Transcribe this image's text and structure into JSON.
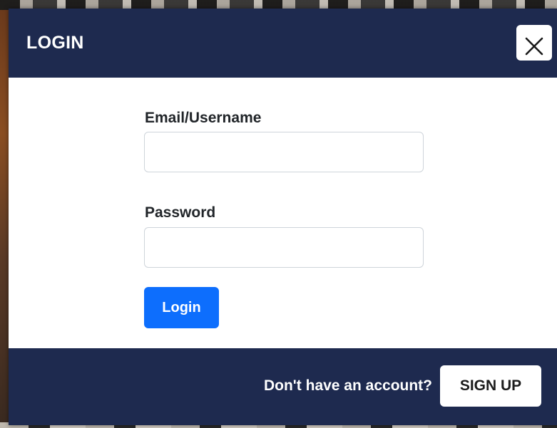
{
  "modal": {
    "title": "LOGIN",
    "close_icon": "close-icon",
    "colors": {
      "header_bg": "#1e2a4f",
      "primary_button": "#0d6efd",
      "text_dark": "#212529"
    }
  },
  "form": {
    "email_label": "Email/Username",
    "email_value": "",
    "email_placeholder": "",
    "password_label": "Password",
    "password_value": "",
    "password_placeholder": "",
    "login_label": "Login"
  },
  "footer": {
    "prompt": "Don't have an account?",
    "signup_label": "SIGN UP"
  }
}
